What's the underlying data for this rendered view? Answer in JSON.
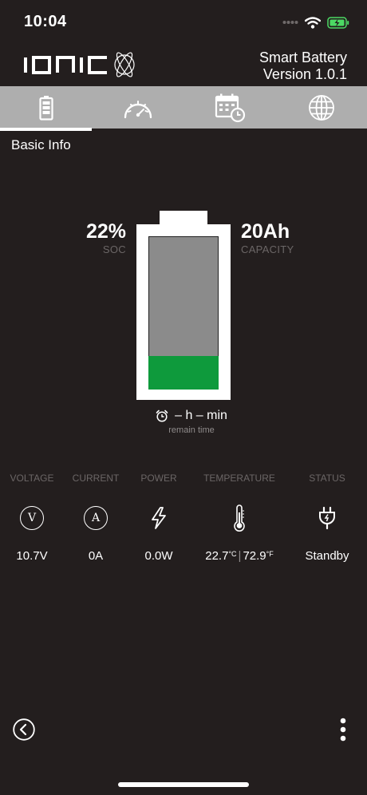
{
  "status_bar": {
    "time": "10:04"
  },
  "header": {
    "logo_text": "IONIC",
    "title": "Smart Battery",
    "version": "Version 1.0.1"
  },
  "tabs": [
    {
      "name": "battery",
      "icon": "battery-icon",
      "active": true
    },
    {
      "name": "gauge",
      "icon": "speedometer-icon",
      "active": false
    },
    {
      "name": "calendar",
      "icon": "calendar-clock-icon",
      "active": false
    },
    {
      "name": "globe",
      "icon": "globe-icon",
      "active": false
    }
  ],
  "section_title": "Basic Info",
  "battery": {
    "soc_value": "22%",
    "soc_label": "SOC",
    "capacity_value": "20Ah",
    "capacity_label": "CAPACITY",
    "fill_fraction": 0.22,
    "remain_time": "– h – min",
    "remain_label": "remain time",
    "fill_color": "#0e9a3c"
  },
  "metrics": {
    "voltage": {
      "label": "VOLTAGE",
      "icon_text": "V",
      "value": "10.7V"
    },
    "current": {
      "label": "CURRENT",
      "icon_text": "A",
      "value": "0A"
    },
    "power": {
      "label": "POWER",
      "value": "0.0W"
    },
    "temperature": {
      "label": "TEMPERATURE",
      "celsius": "22.7",
      "celsius_unit": "°C",
      "separator": "|",
      "fahrenheit": "72.9",
      "fahrenheit_unit": "°F"
    },
    "status": {
      "label": "STATUS",
      "value": "Standby"
    }
  }
}
